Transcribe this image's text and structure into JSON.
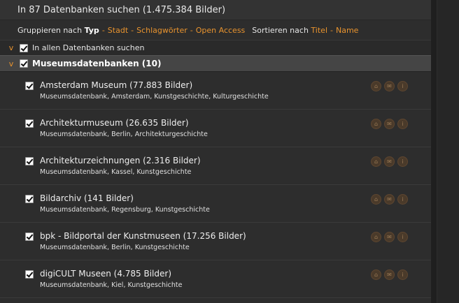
{
  "header": {
    "title": "In 87 Datenbanken suchen (1.475.384 Bilder)"
  },
  "filters": {
    "group_prefix": "Gruppieren nach",
    "group_active": "Typ",
    "group_links": [
      "Stadt",
      "Schlagwörter",
      "Open Access"
    ],
    "separator": "-",
    "sort_prefix": "Sortieren nach",
    "sort_links": [
      "Titel",
      "Name"
    ]
  },
  "search_all": {
    "chevron": "v",
    "label": "In allen Datenbanken suchen",
    "checked": true
  },
  "group": {
    "chevron": "v",
    "label": "Museumsdatenbanken (10)",
    "checked": true
  },
  "items": [
    {
      "name": "Amsterdam Museum (77.883 Bilder)",
      "meta": "Museumsdatenbank, Amsterdam, Kunstgeschichte, Kulturgeschichte",
      "checked": true
    },
    {
      "name": "Architekturmuseum (26.635 Bilder)",
      "meta": "Museumsdatenbank, Berlin, Architekturgeschichte",
      "checked": true
    },
    {
      "name": "Architekturzeichnungen (2.316 Bilder)",
      "meta": "Museumsdatenbank, Kassel, Kunstgeschichte",
      "checked": true
    },
    {
      "name": "Bildarchiv (141 Bilder)",
      "meta": "Museumsdatenbank, Regensburg, Kunstgeschichte",
      "checked": true
    },
    {
      "name": "bpk - Bildportal der Kunstmuseen (17.256 Bilder)",
      "meta": "Museumsdatenbank, Berlin, Kunstgeschichte",
      "checked": true
    },
    {
      "name": "digiCULT Museen (4.785 Bilder)",
      "meta": "Museumsdatenbank, Kiel, Kunstgeschichte",
      "checked": true
    }
  ],
  "icons": {
    "home": "home-icon",
    "mail": "mail-icon",
    "info": "info-icon"
  },
  "colors": {
    "accent": "#e8932e",
    "background": "#2d2d2d",
    "group_bar": "#454545"
  }
}
